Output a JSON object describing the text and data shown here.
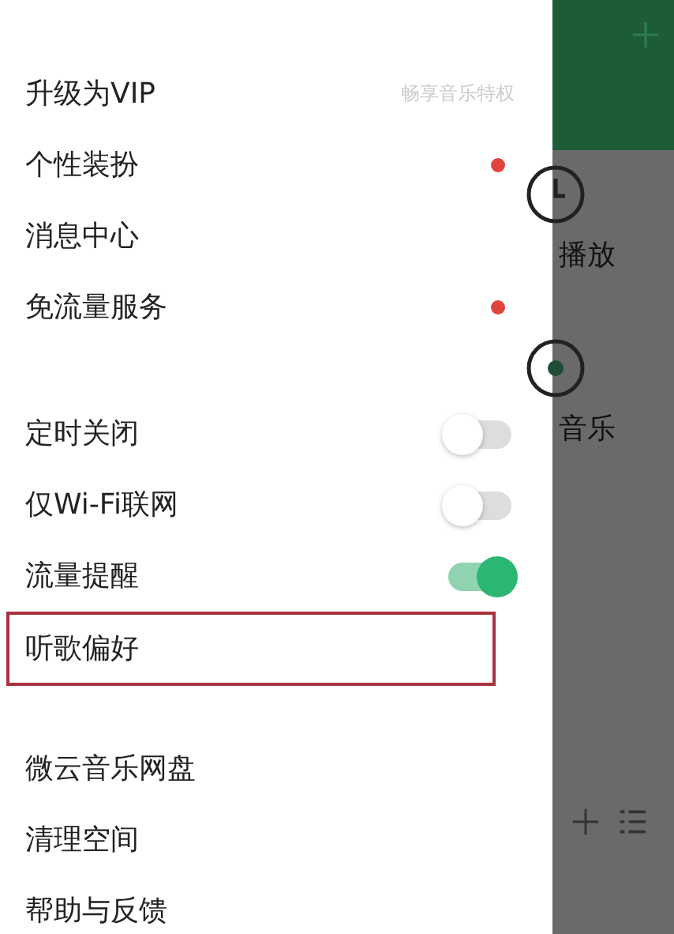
{
  "drawer": {
    "sections": [
      {
        "items": [
          {
            "kind": "value",
            "label": "升级为VIP",
            "value": "畅享音乐特权"
          },
          {
            "kind": "dot",
            "label": "个性装扮",
            "color": "#e0443a"
          },
          {
            "kind": "plain",
            "label": "消息中心"
          },
          {
            "kind": "dot",
            "label": "免流量服务",
            "color": "#e0443a"
          }
        ]
      },
      {
        "items": [
          {
            "kind": "toggle",
            "label": "定时关闭",
            "on": false
          },
          {
            "kind": "toggle",
            "label": "仅Wi-Fi联网",
            "on": false
          },
          {
            "kind": "toggle",
            "label": "流量提醒",
            "on": true
          },
          {
            "kind": "plain",
            "label": "听歌偏好",
            "highlighted": true
          }
        ]
      },
      {
        "items": [
          {
            "kind": "plain",
            "label": "微云音乐网盘"
          },
          {
            "kind": "plain",
            "label": "清理空间"
          },
          {
            "kind": "plain",
            "label": "帮助与反馈"
          }
        ]
      }
    ]
  },
  "background": {
    "entries": [
      {
        "kind": "clock",
        "label": "播放"
      },
      {
        "kind": "disc",
        "label": "音乐"
      }
    ]
  }
}
